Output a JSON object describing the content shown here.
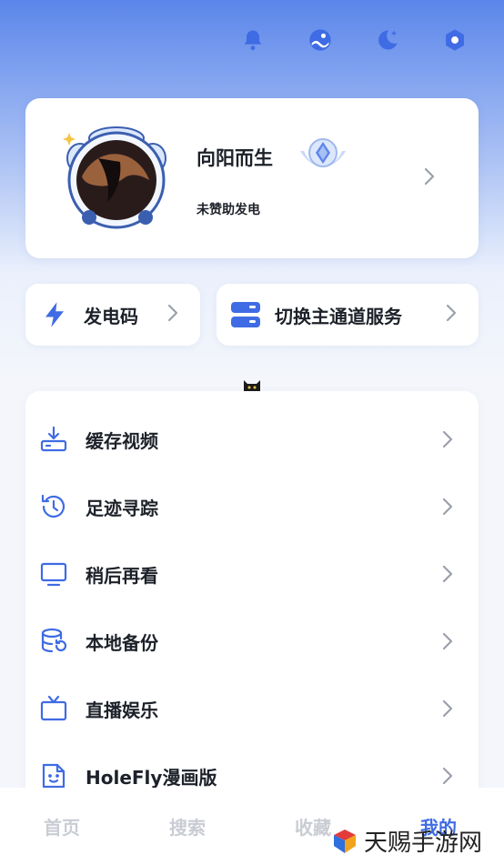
{
  "colors": {
    "accent": "#3f6be4",
    "text": "#1d2129",
    "chevron": "#9aa0ab",
    "tab_inactive": "#c9ccd3"
  },
  "header": {
    "icons": [
      "bell-icon",
      "theme-landscape-icon",
      "night-mode-icon",
      "settings-icon"
    ]
  },
  "profile": {
    "username": "向阳而生",
    "sponsor_status": "未赞助发电"
  },
  "quick_actions": [
    {
      "label": "发电码",
      "icon": "lightning-icon"
    },
    {
      "label": "切换主通道服务",
      "icon": "server-switch-icon"
    }
  ],
  "menu": [
    {
      "label": "缓存视频",
      "icon": "download-cache-icon"
    },
    {
      "label": "足迹寻踪",
      "icon": "history-icon"
    },
    {
      "label": "稍后再看",
      "icon": "monitor-icon"
    },
    {
      "label": "本地备份",
      "icon": "database-restore-icon"
    },
    {
      "label": "直播娱乐",
      "icon": "tv-icon"
    },
    {
      "label": "HoleFly漫画版",
      "icon": "comic-file-icon"
    }
  ],
  "tabs": [
    {
      "label": "首页"
    },
    {
      "label": "搜索"
    },
    {
      "label": "收藏"
    },
    {
      "label": "我的"
    }
  ],
  "watermark": {
    "text": "天赐手游网"
  }
}
